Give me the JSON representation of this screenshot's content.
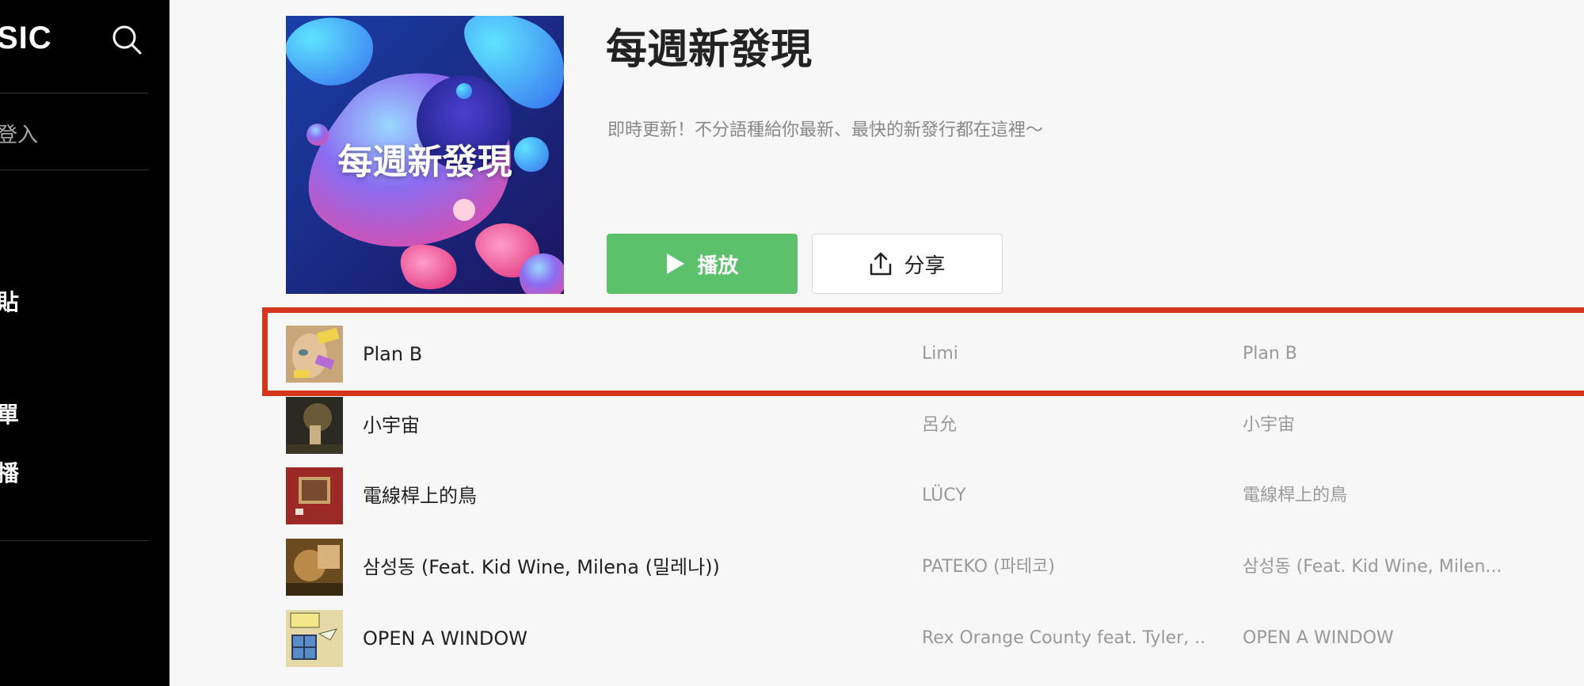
{
  "sidebar": {
    "brand": "SIC",
    "login_text": "登入",
    "items": [
      {
        "label": "貼"
      },
      {
        "label": "單"
      },
      {
        "label": "播"
      }
    ]
  },
  "playlist": {
    "cover_title": "每週新發現",
    "title": "每週新發現",
    "description": "即時更新！不分語種給你最新、最快的新發行都在這裡～",
    "play_label": "播放",
    "share_label": "分享"
  },
  "tracks": [
    {
      "title": "Plan B",
      "artist": "Limi",
      "album": "Plan B"
    },
    {
      "title": "小宇宙",
      "artist": "呂允",
      "album": "小宇宙"
    },
    {
      "title": "電線桿上的鳥",
      "artist": "LÜCY",
      "album": "電線桿上的鳥"
    },
    {
      "title": "삼성동 (Feat. Kid Wine, Milena (밀레나))",
      "artist": "PATEKO (파테코)",
      "album": "삼성동 (Feat. Kid Wine, Milen..."
    },
    {
      "title": "OPEN A WINDOW",
      "artist": "Rex Orange County feat. Tyler, ...",
      "album": "OPEN A WINDOW"
    }
  ],
  "colors": {
    "play_button": "#5bc26b",
    "highlight": "#d4351c",
    "sidebar_bg": "#000000"
  }
}
